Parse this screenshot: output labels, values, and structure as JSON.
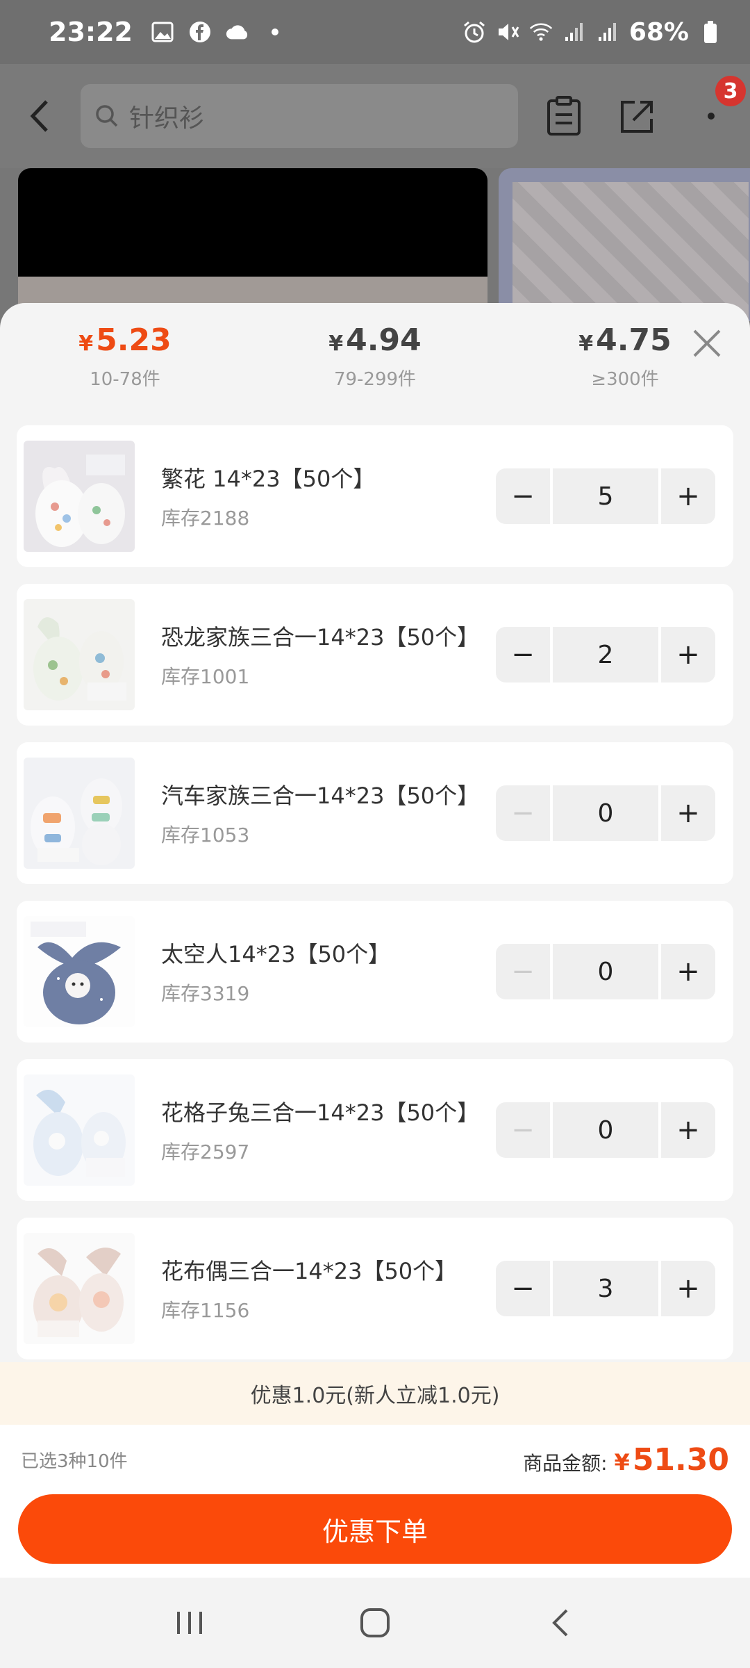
{
  "status_bar": {
    "time": "23:22",
    "battery": "68%",
    "icons": [
      "gallery-icon",
      "facebook-icon",
      "cloud-icon",
      "dot-icon",
      "alarm-icon",
      "mute-icon",
      "wifi-icon",
      "signal-icon",
      "signal-icon",
      "battery-icon"
    ]
  },
  "header": {
    "search_text": "针织衫",
    "cart_badge": "3"
  },
  "price_tiers": [
    {
      "currency": "¥",
      "price": "5.23",
      "range": "10-78件",
      "active": true
    },
    {
      "currency": "¥",
      "price": "4.94",
      "range": "79-299件",
      "active": false
    },
    {
      "currency": "¥",
      "price": "4.75",
      "range": "≥300件",
      "active": false
    }
  ],
  "skus": [
    {
      "name": "繁花 14*23【50个】",
      "stock": "库存2188",
      "quantity": "5",
      "minus_disabled": false,
      "thumb_color": "#e8e6ea"
    },
    {
      "name": "恐龙家族三合一14*23【50个】",
      "stock": "库存1001",
      "quantity": "2",
      "minus_disabled": false,
      "thumb_color": "#eef0ec"
    },
    {
      "name": "汽车家族三合一14*23【50个】",
      "stock": "库存1053",
      "quantity": "0",
      "minus_disabled": true,
      "thumb_color": "#eceef2"
    },
    {
      "name": "太空人14*23【50个】",
      "stock": "库存3319",
      "quantity": "0",
      "minus_disabled": true,
      "thumb_color": "#6f7fa4"
    },
    {
      "name": "花格子兔三合一14*23【50个】",
      "stock": "库存2597",
      "quantity": "0",
      "minus_disabled": true,
      "thumb_color": "#dfe7f2"
    },
    {
      "name": "花布偶三合一14*23【50个】",
      "stock": "库存1156",
      "quantity": "3",
      "minus_disabled": false,
      "thumb_color": "#eadcd6"
    }
  ],
  "stepper": {
    "minus": "−",
    "plus": "+"
  },
  "promo": "优惠1.0元(新人立减1.0元)",
  "summary": {
    "selected": "已选3种10件",
    "total_label": "商品金额:",
    "currency": "¥",
    "total_amount": "51.30"
  },
  "order_button": "优惠下单",
  "colors": {
    "accent": "#ee4b14",
    "button": "#fb4a0a",
    "promo_bg": "#fdf5e9"
  }
}
